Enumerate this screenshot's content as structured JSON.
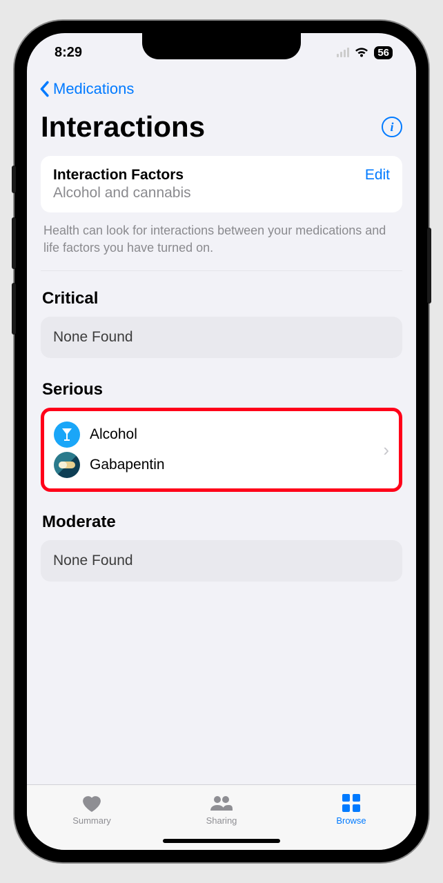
{
  "status": {
    "time": "8:29",
    "battery": "56"
  },
  "nav": {
    "back_label": "Medications"
  },
  "page": {
    "title": "Interactions"
  },
  "factors_card": {
    "title": "Interaction Factors",
    "subtitle": "Alcohol and cannabis",
    "edit_label": "Edit"
  },
  "helper": "Health can look for interactions between your medications and life factors you have turned on.",
  "sections": {
    "critical": {
      "title": "Critical",
      "none_label": "None Found"
    },
    "serious": {
      "title": "Serious",
      "items": [
        {
          "label": "Alcohol",
          "icon": "alcohol-icon"
        },
        {
          "label": "Gabapentin",
          "icon": "pill-icon"
        }
      ]
    },
    "moderate": {
      "title": "Moderate",
      "none_label": "None Found"
    }
  },
  "tabs": {
    "summary": "Summary",
    "sharing": "Sharing",
    "browse": "Browse"
  }
}
